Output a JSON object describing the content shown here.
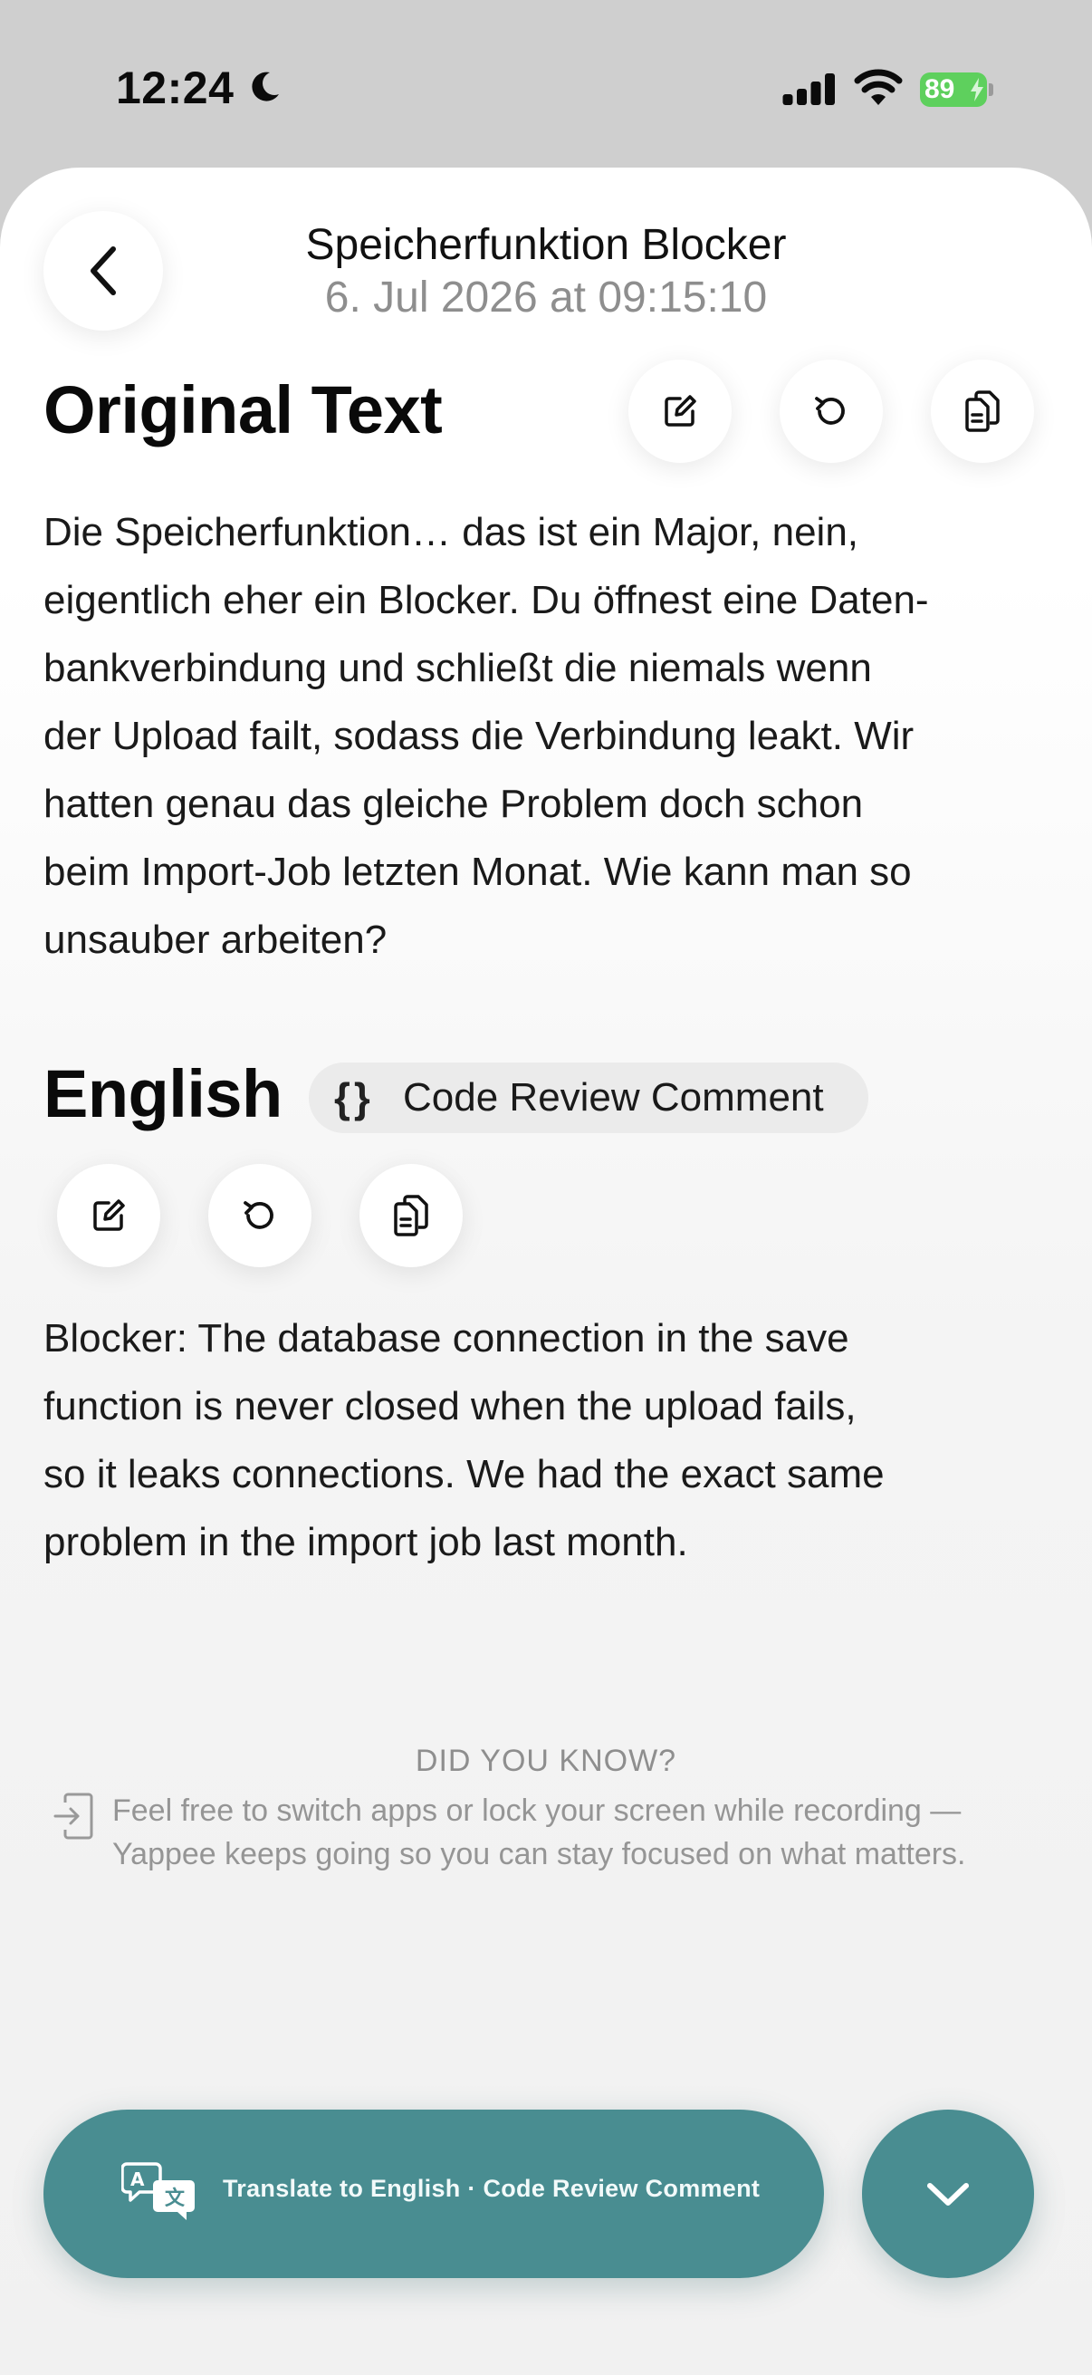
{
  "status_bar": {
    "time": "12:24",
    "battery": "89"
  },
  "header": {
    "title": "Speicherfunktion Blocker",
    "date": "6. Jul 2026 at 09:15:10"
  },
  "original": {
    "heading": "Original Text",
    "lines": [
      "Die Speicherfunktion… das ist ein Major, nein,",
      "eigentlich eher ein Blocker. Du öffnest eine Daten-",
      "bankverbindung und schließt die niemals wenn",
      "der Upload failt, sodass die Verbindung leakt. Wir",
      "hatten genau das gleiche Problem doch schon",
      "beim Import-Job letzten Monat. Wie kann man so",
      "unsauber arbeiten?"
    ]
  },
  "translation": {
    "heading": "English",
    "style_icon": "{}",
    "style_label": "Code Review Comment",
    "lines": [
      "Blocker: The database connection in the save",
      "function is never closed when the upload fails,",
      "so it leaks connections. We had the exact same",
      "problem in the import job last month."
    ]
  },
  "did_you_know": {
    "title": "DID YOU KNOW?",
    "text": "Feel free to switch apps or lock your screen while recording — Yappee keeps going so you can stay focused on what matters."
  },
  "actions": {
    "translate_label": "Translate to English · Code Review Comment"
  },
  "icons": {
    "back": "chevron-left-icon",
    "edit": "edit-icon",
    "regenerate": "refresh-icon",
    "copy": "copy-icon",
    "tip": "exit-icon",
    "translate": "translate-icon",
    "expand": "chevron-down-icon"
  },
  "colors": {
    "accent": "#498d91",
    "battery": "#5ed05d",
    "muted_text": "#8e8e8e"
  }
}
